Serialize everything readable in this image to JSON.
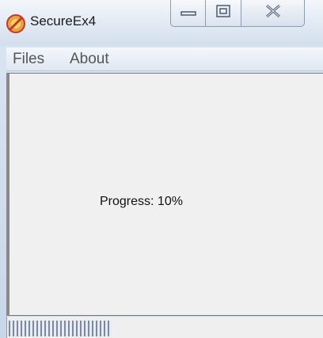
{
  "window": {
    "title": "SecureEx4",
    "icon": "app-icon"
  },
  "caption_buttons": {
    "minimize_icon": "minimize-icon",
    "maximize_icon": "maximize-icon",
    "close_icon": "close-icon"
  },
  "menu": {
    "items": [
      {
        "label": "Files"
      },
      {
        "label": "About"
      }
    ]
  },
  "content": {
    "progress_text": "Progress: 10%"
  },
  "status": {
    "progress_fraction": 0.33
  },
  "colors": {
    "accent": "#7a8aa0",
    "window_bg": "#f0f0f0"
  }
}
